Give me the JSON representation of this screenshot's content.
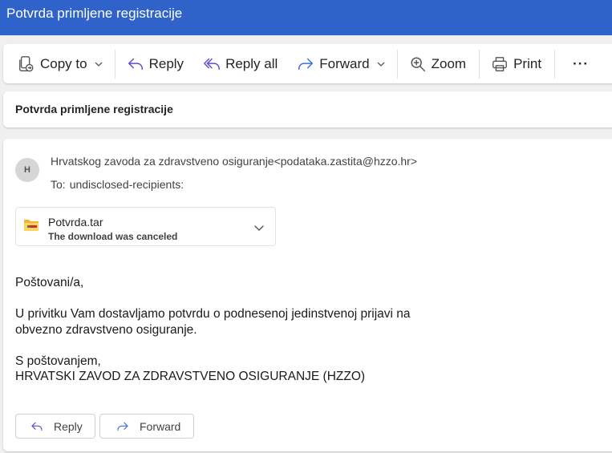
{
  "window": {
    "title": "Potvrda primljene registracije"
  },
  "toolbar": {
    "copy_to": "Copy to",
    "reply": "Reply",
    "reply_all": "Reply all",
    "forward": "Forward",
    "zoom": "Zoom",
    "print": "Print",
    "more": "···"
  },
  "message": {
    "subject": "Potvrda primljene registracije",
    "avatar_initial": "H",
    "from": "Hrvatskog zavoda za zdravstveno osiguranje<podataka.zastita@hzzo.hr>",
    "to_label": "To:",
    "to": "undisclosed-recipients:",
    "attachment": {
      "name": "Potvrda.tar",
      "status": "The download was canceled"
    },
    "body": {
      "greeting": "Poštovani/a,",
      "line1": "U privitku Vam dostavljamo potvrdu o podnesenoj jedinstvenoj prijavi na",
      "line2": "obvezno zdravstveno osiguranje.",
      "signoff": "S poštovanjem,",
      "signature": "HRVATSKI ZAVOD ZA ZDRAVSTVENO OSIGURANJE (HZZO)"
    },
    "actions": {
      "reply": "Reply",
      "forward": "Forward"
    }
  },
  "colors": {
    "titlebar": "#2f63c9",
    "accent_icon": "#5b4fc9",
    "folder_icon": "#f2b52b"
  }
}
